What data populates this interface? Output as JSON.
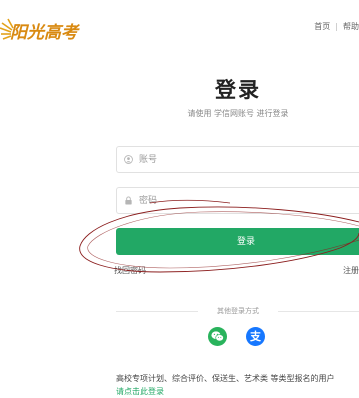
{
  "header": {
    "logo_text": "阳光高考",
    "nav": {
      "home": "首页",
      "separator": "|",
      "help": "帮助"
    }
  },
  "login": {
    "title": "登录",
    "subtitle": "请使用 学信网账号 进行登录",
    "account_placeholder": "账号",
    "password_placeholder": "密码",
    "submit_label": "登录",
    "forgot_password": "找回密码",
    "register": "注册"
  },
  "other_methods": {
    "label": "其他登录方式",
    "icons": [
      "wechat-icon",
      "alipay-icon"
    ],
    "alipay_char": "支"
  },
  "notice": {
    "text": "高校专项计划、综合评价、保送生、艺术类 等类型报名的用户",
    "link": "请点击此登录"
  },
  "colors": {
    "brand_green": "#22a865",
    "wechat_green": "#29b35c",
    "alipay_blue": "#1677ff",
    "logo_orange": "#d98a12",
    "scribble_red": "#8b1d1d"
  }
}
